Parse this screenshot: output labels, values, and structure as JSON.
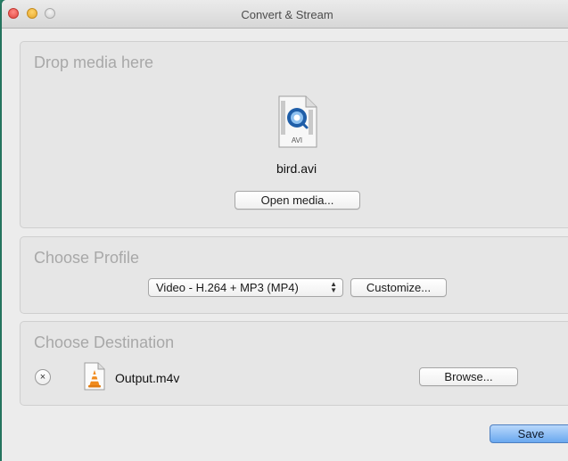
{
  "window": {
    "title": "Convert & Stream"
  },
  "drop_panel": {
    "title": "Drop media here",
    "file_icon_label": "AVI",
    "file_name": "bird.avi",
    "open_button": "Open media..."
  },
  "profile_panel": {
    "title": "Choose Profile",
    "selected_profile": "Video - H.264 + MP3 (MP4)",
    "customize_button": "Customize..."
  },
  "destination_panel": {
    "title": "Choose Destination",
    "remove_symbol": "×",
    "file_name": "Output.m4v",
    "browse_button": "Browse..."
  },
  "footer": {
    "save_button": "Save"
  },
  "colors": {
    "desktop": "#2a8a70",
    "save_button": "#6aa8ef"
  }
}
